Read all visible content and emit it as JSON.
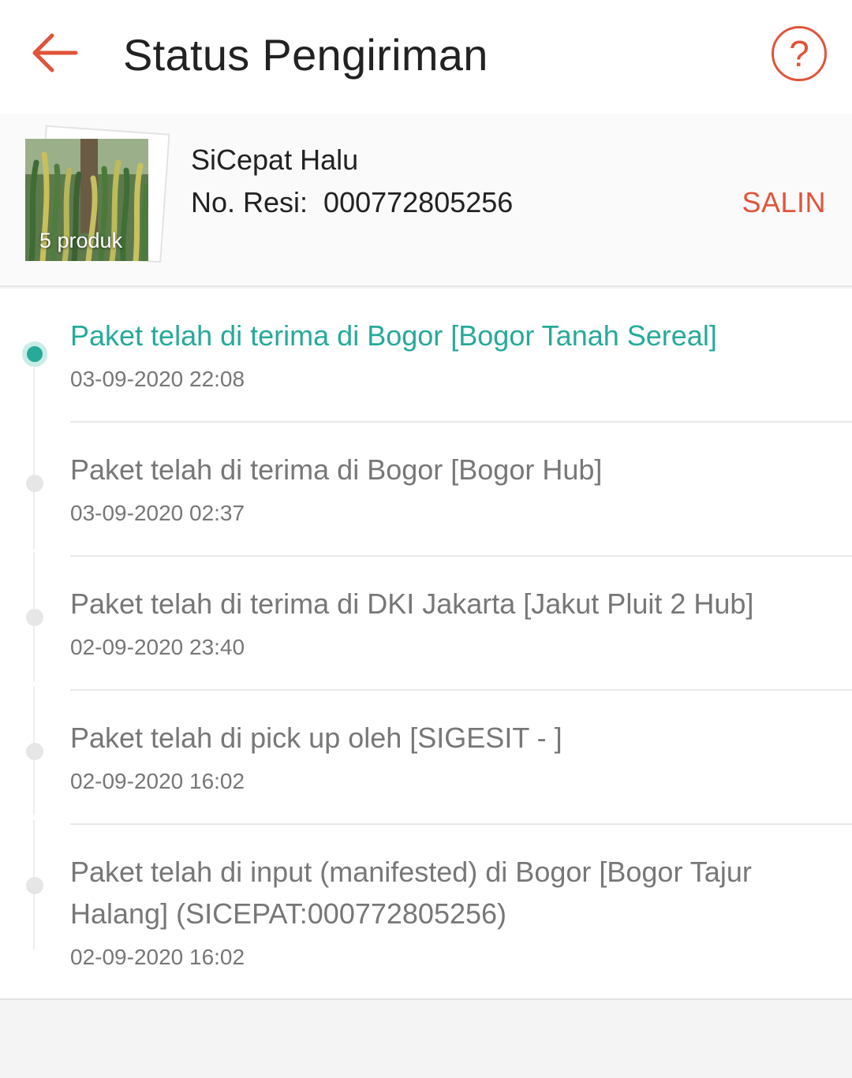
{
  "header": {
    "title": "Status Pengiriman",
    "back_icon": "arrow-left-icon",
    "help_icon": "question-circle-icon",
    "help_glyph": "?",
    "accent_color": "#e1543a"
  },
  "shipment": {
    "thumbnail_label": "5 produk",
    "courier": "SiCepat Halu",
    "resi_text": "No. Resi:  000772805256",
    "copy_label": "SALIN"
  },
  "timeline": {
    "active_color": "#26aa99",
    "inactive_color": "#777777",
    "events": [
      {
        "description": "Paket telah di terima di Bogor [Bogor Tanah Sereal]",
        "time": "03-09-2020 22:08",
        "active": true
      },
      {
        "description": "Paket telah di terima di Bogor [Bogor Hub]",
        "time": "03-09-2020 02:37",
        "active": false
      },
      {
        "description": "Paket telah di terima di DKI Jakarta [Jakut Pluit 2 Hub]",
        "time": "02-09-2020 23:40",
        "active": false
      },
      {
        "description": "Paket telah di pick up oleh [SIGESIT - ]",
        "time": "02-09-2020 16:02",
        "active": false
      },
      {
        "description": "Paket telah di input (manifested) di Bogor [Bogor Tajur Halang] (SICEPAT:000772805256)",
        "time": "02-09-2020 16:02",
        "active": false
      }
    ]
  }
}
